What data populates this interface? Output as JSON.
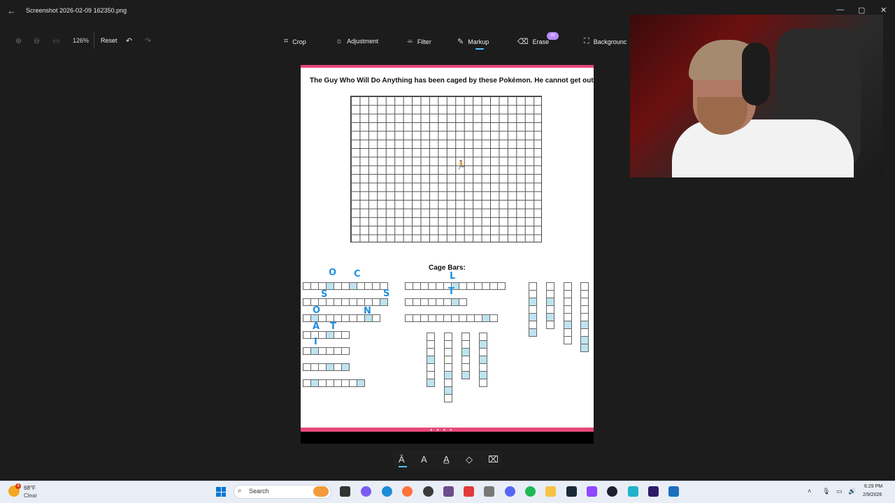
{
  "window": {
    "back_icon": "back-arrow-icon",
    "title": "Screenshot 2026-02-09 162350.png",
    "controls": [
      "—",
      "▢",
      "✕"
    ]
  },
  "toolbar": {
    "zoom_value": "126%",
    "reset_label": "Reset",
    "tools": [
      {
        "name": "crop",
        "label": "Crop",
        "icon": "crop-icon"
      },
      {
        "name": "adjustment",
        "label": "Adjustment",
        "icon": "brightness-icon"
      },
      {
        "name": "filter",
        "label": "Filter",
        "icon": "filter-icon"
      },
      {
        "name": "markup",
        "label": "Markup",
        "icon": "pen-icon"
      },
      {
        "name": "erase",
        "label": "Erase",
        "icon": "eraser-icon"
      },
      {
        "name": "background",
        "label": "Backgrounc",
        "icon": "background-icon"
      }
    ],
    "ai_badge": "AI",
    "accent": "#4cc2ff"
  },
  "document": {
    "title": "The Guy Who Will Do Anything has been caged by these Pokémon. He cannot get out.",
    "cage_bars_label": "Cage Bars:",
    "border_color": "#e8487b",
    "highlight_color": "#bfe3f0",
    "ink_color": "#1f8fe0",
    "handwritten": [
      "O",
      "C",
      "S",
      "S",
      "O",
      "N",
      "A",
      "T",
      "I",
      "L",
      "T"
    ]
  },
  "drawbar": {
    "tools": [
      "ballpoint-pen-icon",
      "text-pen-icon",
      "highlighter-icon",
      "eraser-icon",
      "clear-icon"
    ]
  },
  "taskbar": {
    "weather_temp": "68°F",
    "weather_cond": "Clear",
    "weather_badge": "4",
    "search_label": "Search",
    "clock_time": "6:29 PM",
    "clock_date": "2/9/2026"
  }
}
